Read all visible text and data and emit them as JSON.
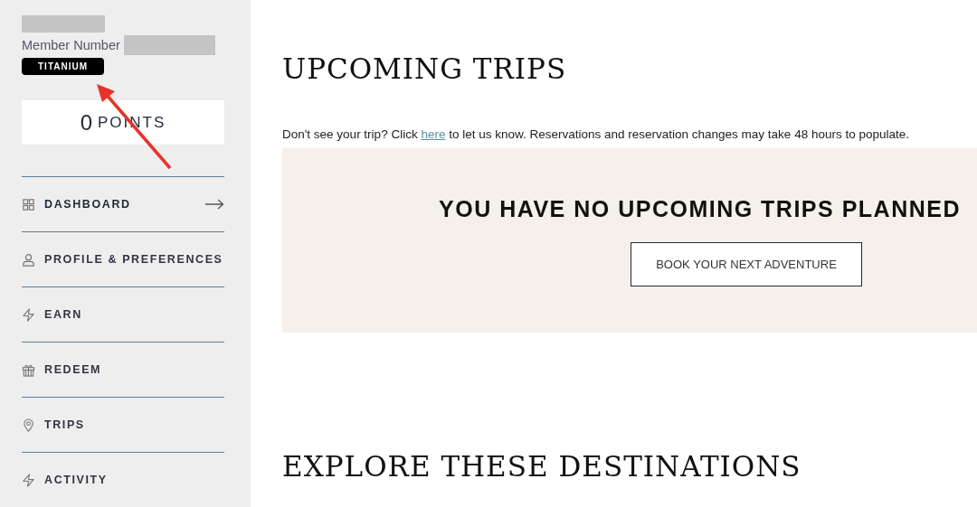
{
  "member": {
    "number_label": "Member Number",
    "tier": "TITANIUM",
    "points": "0",
    "points_label": "POINTS"
  },
  "nav": [
    {
      "label": "DASHBOARD",
      "kind": "grid",
      "selected": true
    },
    {
      "label": "PROFILE & PREFERENCES",
      "kind": "person",
      "selected": false
    },
    {
      "label": "EARN",
      "kind": "bolt",
      "selected": false
    },
    {
      "label": "REDEEM",
      "kind": "gift",
      "selected": false
    },
    {
      "label": "TRIPS",
      "kind": "pin",
      "selected": false
    },
    {
      "label": "ACTIVITY",
      "kind": "bolt",
      "selected": false
    }
  ],
  "upcoming": {
    "title": "UPCOMING TRIPS",
    "note_before": "Don't see your trip? Click ",
    "note_link": "here",
    "note_after": " to let us know. Reservations and reservation changes may take 48 hours to populate.",
    "empty_message": "YOU HAVE NO UPCOMING TRIPS PLANNED",
    "button": "BOOK YOUR NEXT ADVENTURE"
  },
  "explore": {
    "title": "EXPLORE THESE DESTINATIONS"
  }
}
